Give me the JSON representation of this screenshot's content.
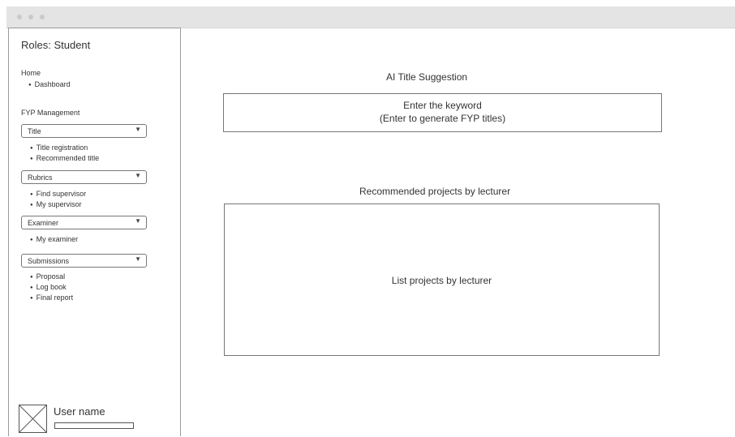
{
  "sidebar": {
    "role_label": "Roles: Student",
    "home": {
      "heading": "Home",
      "items": [
        "Dashboard"
      ]
    },
    "fyp_heading": "FYP Management",
    "groups": [
      {
        "label": "Title",
        "items": [
          "Title registration",
          "Recommended title"
        ]
      },
      {
        "label": "Rubrics",
        "items": [
          "Find supervisor",
          "My supervisor"
        ]
      },
      {
        "label": "Examiner",
        "items": [
          "My examiner"
        ]
      },
      {
        "label": "Submissions",
        "items": [
          "Proposal",
          "Log book",
          "Final report"
        ]
      }
    ],
    "user": {
      "name": "User name"
    }
  },
  "main": {
    "title": "AI Title Suggestion",
    "keyword_input": {
      "line1": "Enter the keyword",
      "line2": "(Enter to generate FYP titles)"
    },
    "recommended": {
      "heading": "Recommended projects by lecturer",
      "placeholder": "List projects by lecturer"
    }
  },
  "icons": {
    "dropdown": "chevron-down-icon",
    "avatar": "image-placeholder-icon"
  }
}
